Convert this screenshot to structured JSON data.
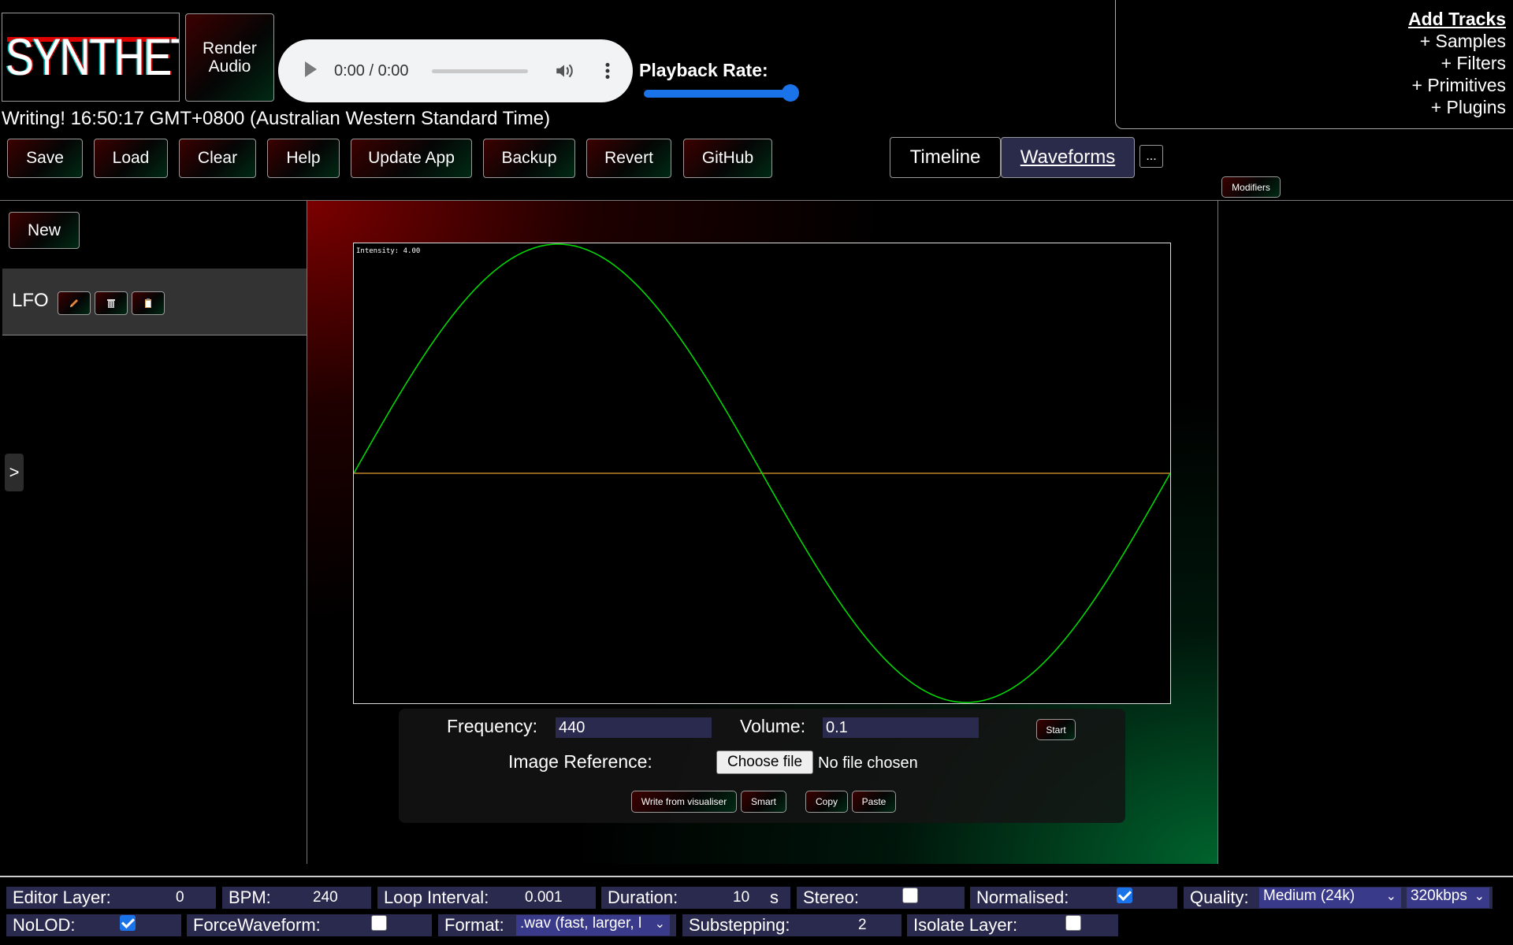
{
  "app": {
    "logo_text": "SYNTHETIC",
    "render_audio_label": "Render Audio",
    "audio_time": "0:00 / 0:00",
    "playback_rate_label": "Playback Rate:",
    "playback_rate_fraction": 1.0,
    "status": "Writing! 16:50:17 GMT+0800 (Australian Western Standard Time)"
  },
  "toolbar": {
    "buttons": [
      "Save",
      "Load",
      "Clear",
      "Help",
      "Update App",
      "Backup",
      "Revert",
      "GitHub"
    ]
  },
  "add_tracks": {
    "title": "Add Tracks",
    "items": [
      "+ Samples",
      "+ Filters",
      "+ Primitives",
      "+ Plugins"
    ]
  },
  "tabs": {
    "timeline": "Timeline",
    "waveforms": "Waveforms",
    "more": "...",
    "modifiers": "Modifiers"
  },
  "sidebar": {
    "new_label": "New",
    "items": [
      {
        "name": "LFO",
        "actions": [
          "edit-icon",
          "delete-icon",
          "clipboard-icon"
        ]
      }
    ],
    "expander": ">"
  },
  "visualiser": {
    "intensity_text": "Intensity: 4.00",
    "wave_color": "#00e000",
    "baseline_color": "#e3a030",
    "waveform": "sine",
    "cycles": 1
  },
  "editor": {
    "frequency_label": "Frequency:",
    "frequency_value": "440",
    "volume_label": "Volume:",
    "volume_value": "0.1",
    "start_label": "Start",
    "image_reference_label": "Image Reference:",
    "choose_file_label": "Choose file",
    "no_file_label": "No file chosen",
    "write_label": "Write from visualiser",
    "smart_label": "Smart",
    "copy_label": "Copy",
    "paste_label": "Paste"
  },
  "settings": {
    "editor_layer_label": "Editor Layer:",
    "editor_layer_value": "0",
    "bpm_label": "BPM:",
    "bpm_value": "240",
    "loop_interval_label": "Loop Interval:",
    "loop_interval_value": "0.001",
    "duration_label": "Duration:",
    "duration_value": "10",
    "duration_unit": "s",
    "stereo_label": "Stereo:",
    "stereo_checked": false,
    "normalised_label": "Normalised:",
    "normalised_checked": true,
    "quality_label": "Quality:",
    "quality_value": "Medium (24k)",
    "bitrate_value": "320kbps",
    "nolod_label": "NoLOD:",
    "nolod_checked": true,
    "force_waveform_label": "ForceWaveform:",
    "force_waveform_checked": false,
    "format_label": "Format:",
    "format_value": ".wav (fast, larger, l",
    "substepping_label": "Substepping:",
    "substepping_value": "2",
    "isolate_layer_label": "Isolate Layer:",
    "isolate_layer_checked": false
  },
  "colors": {
    "accent": "#1a73e8",
    "field_bg": "#2a2a4e"
  }
}
